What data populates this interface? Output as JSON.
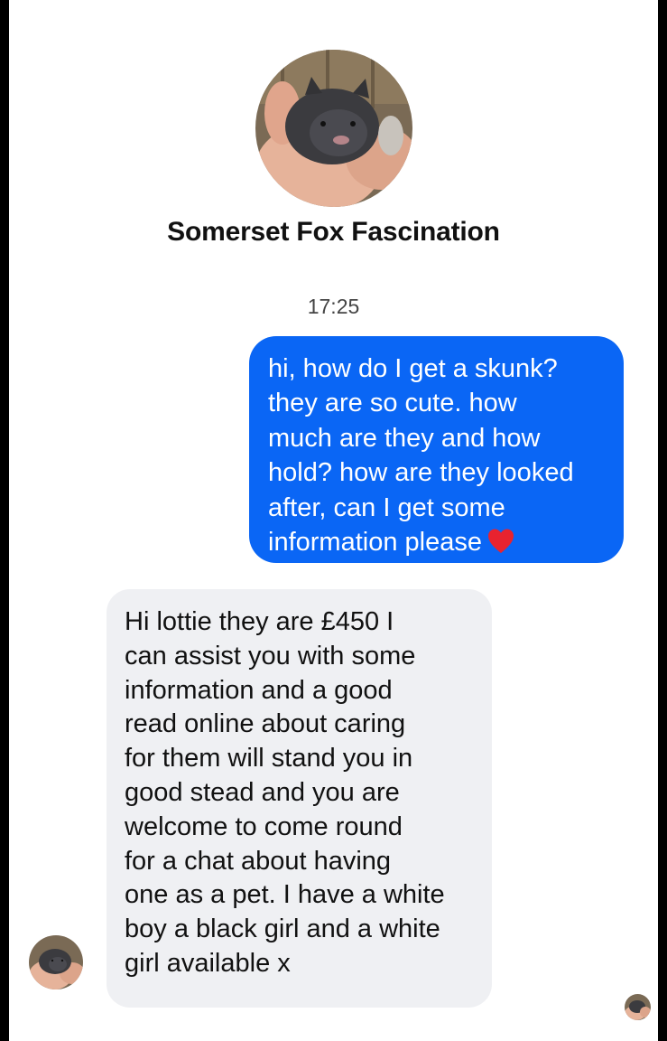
{
  "conversation": {
    "contact_name": "Somerset Fox Fascination",
    "timestamp": "17:25"
  },
  "messages": [
    {
      "direction": "outgoing",
      "text": "hi, how do I get a skunk?\nthey are so cute. how\nmuch are they and how\nhold? how are they looked\nafter, can I get some\ninformation please",
      "emoji": "heart-icon"
    },
    {
      "direction": "incoming",
      "text": "Hi lottie they are £450 I\ncan assist you with some\ninformation and a good\nread online about caring\nfor them will stand you in\ngood stead and you are\nwelcome to come round\nfor a chat about having\none as a pet. I have a white\nboy a black girl and a white\ngirl available x"
    }
  ],
  "colors": {
    "outgoing_bubble": "#0a66f5",
    "incoming_bubble": "#eff0f3",
    "heart": "#e8232f",
    "background": "#ffffff"
  }
}
